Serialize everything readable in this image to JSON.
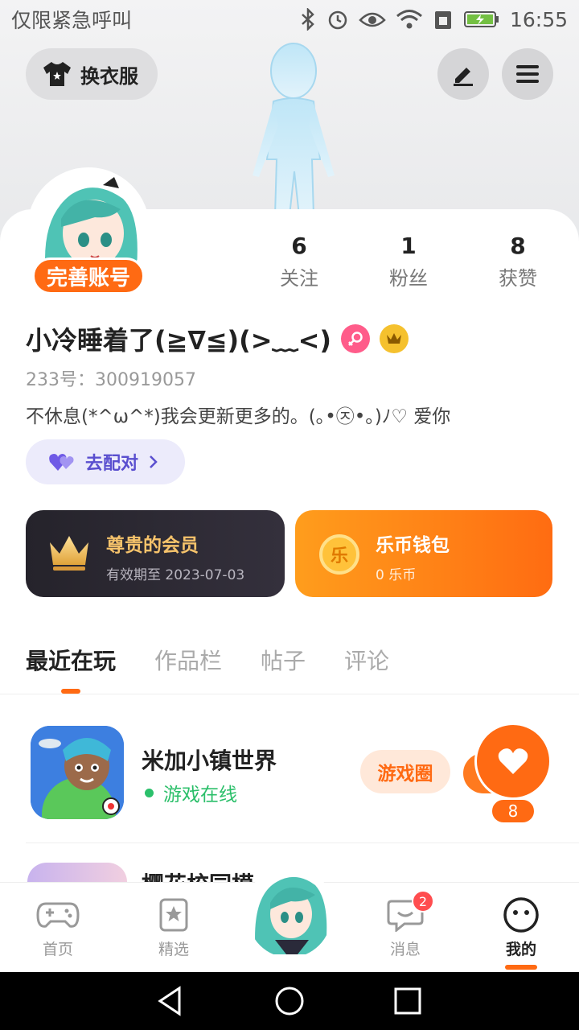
{
  "status_bar": {
    "left_text": "仅限紧急呼叫",
    "time": "16:55"
  },
  "hero": {
    "dress_label": "换衣服"
  },
  "profile": {
    "complete_label": "完善账号",
    "stats": [
      {
        "num": "6",
        "label": "关注"
      },
      {
        "num": "1",
        "label": "粉丝"
      },
      {
        "num": "8",
        "label": "获赞"
      }
    ],
    "nickname": "小冷睡着了(≧∇≦)(>﹏<)",
    "uid": "233号：300919057",
    "bio": "不休息(*^ω^*)我会更新更多的。(｡•㉨•｡)ﾉ♡ 爱你",
    "match_label": "去配对"
  },
  "vip_card": {
    "title": "尊贵的会员",
    "subtitle": "有效期至 2023-07-03",
    "icon": "crown-icon"
  },
  "wallet_card": {
    "title": "乐币钱包",
    "subtitle": "0 乐币",
    "coin_char": "乐"
  },
  "tabs": [
    {
      "label": "最近在玩",
      "active": true
    },
    {
      "label": "作品栏",
      "active": false
    },
    {
      "label": "帖子",
      "active": false
    },
    {
      "label": "评论",
      "active": false
    }
  ],
  "games": [
    {
      "name": "米加小镇世界",
      "status": "游戏在线",
      "circle_label": "游戏圈",
      "likes": "8"
    },
    {
      "name": "樱花校园模",
      "status": "",
      "circle_label": "",
      "likes": ""
    }
  ],
  "bottom_nav": [
    {
      "label": "首页",
      "icon": "gamepad-icon"
    },
    {
      "label": "精选",
      "icon": "star-bookmark-icon"
    },
    {
      "label": "",
      "icon": "avatar"
    },
    {
      "label": "消息",
      "icon": "chat-icon",
      "badge": "2"
    },
    {
      "label": "我的",
      "icon": "smile-face-icon",
      "active": true
    }
  ],
  "colors": {
    "accent": "#ff6a13",
    "vip_bg": "#2a2730",
    "match_text": "#5a4fcf",
    "online": "#2bbf6a"
  }
}
